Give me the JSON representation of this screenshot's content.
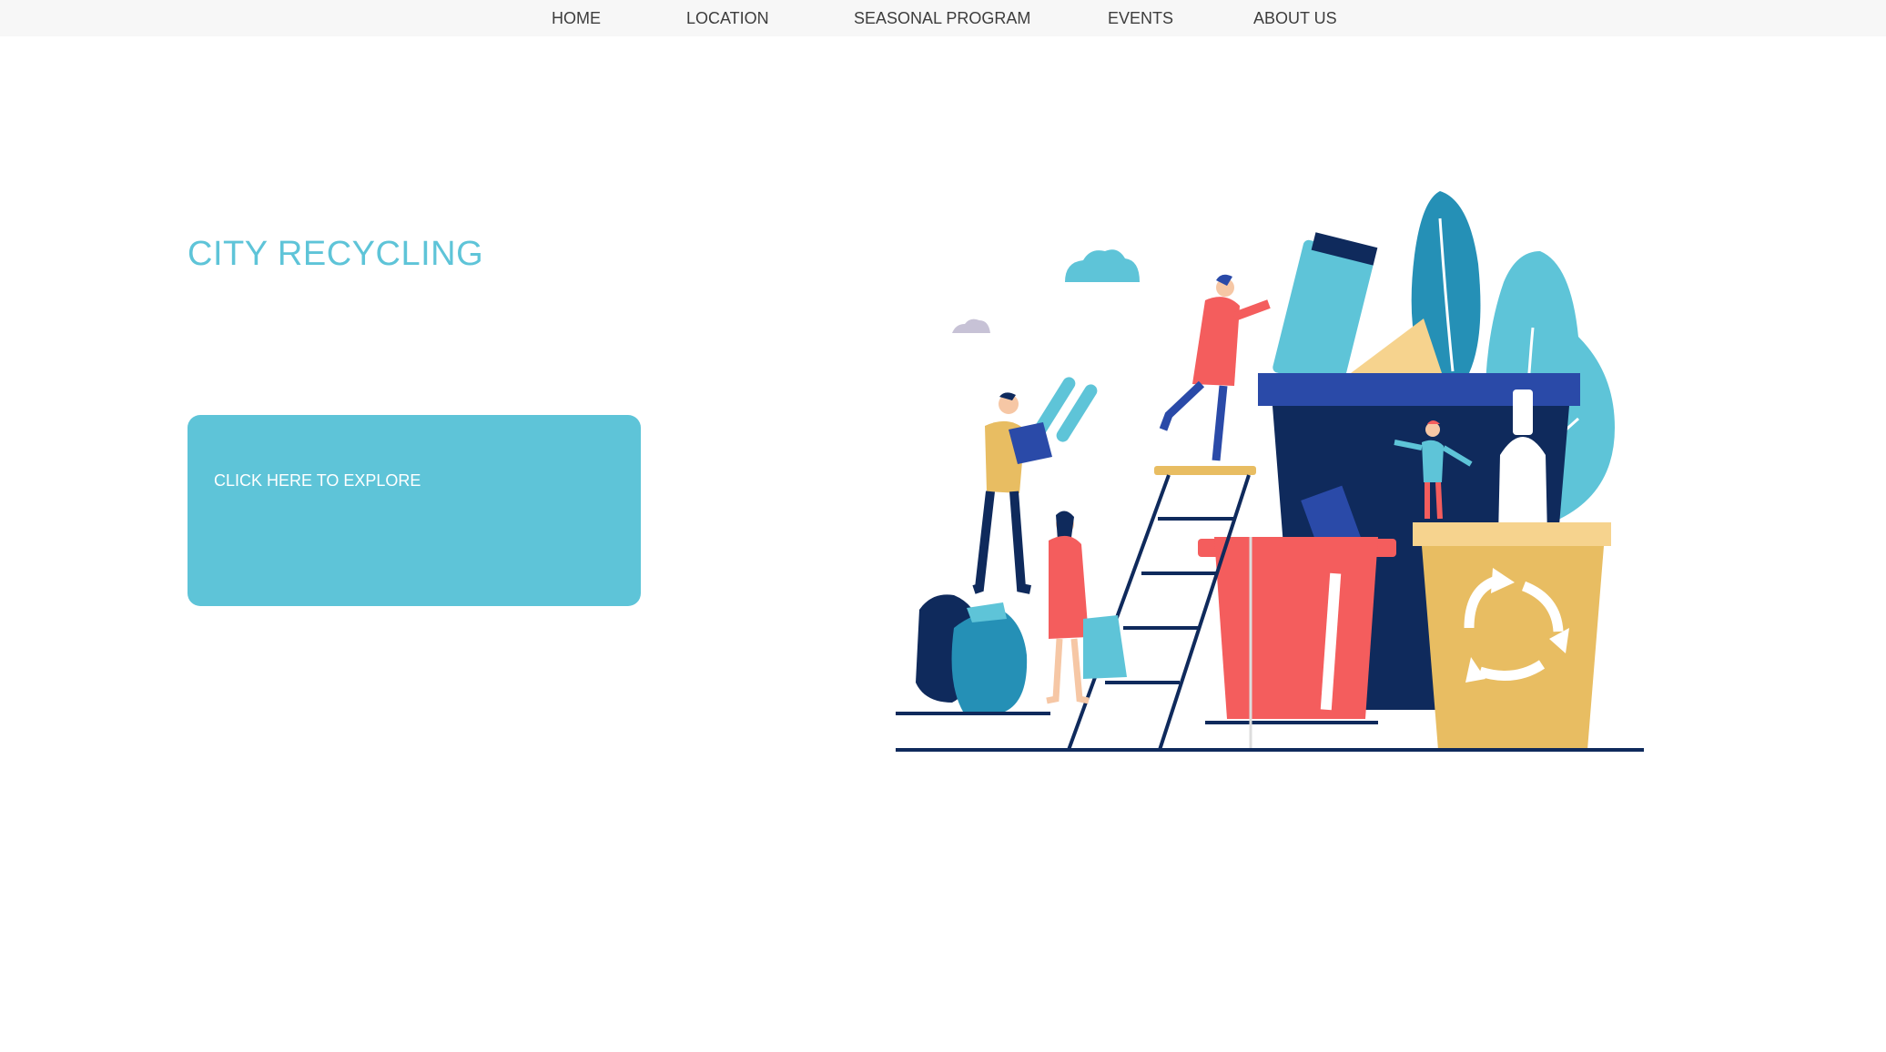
{
  "nav": {
    "items": [
      {
        "label": "HOME"
      },
      {
        "label": "LOCATION"
      },
      {
        "label": "SEASONAL PROGRAM"
      },
      {
        "label": "EVENTS"
      },
      {
        "label": "ABOUT US"
      }
    ]
  },
  "hero": {
    "title": "CITY RECYCLING",
    "button_label": "CLICK HERE TO EXPLORE"
  },
  "illustration": {
    "icon": "recycle-icon"
  },
  "colors": {
    "accent": "#5ec4d8",
    "navy": "#0f2a5c",
    "coral": "#f45d5d",
    "mustard": "#e8bd62",
    "teal": "#2590b6",
    "royal_blue": "#2a4aa8"
  }
}
